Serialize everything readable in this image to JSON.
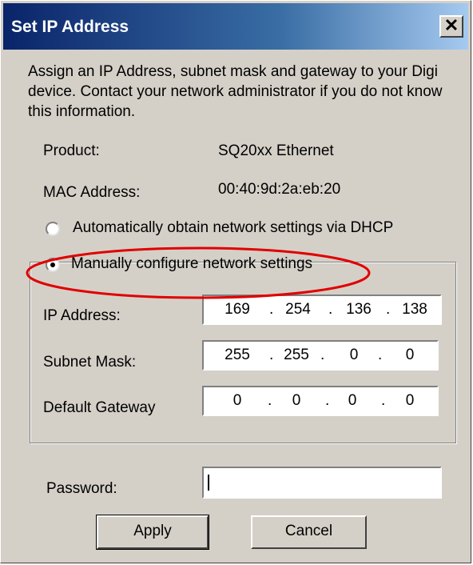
{
  "window": {
    "title": "Set IP Address",
    "close_glyph": "✕"
  },
  "description": "Assign an IP Address, subnet mask and gateway to your Digi device.  Contact your network administrator if you do not know this information.",
  "product": {
    "label": "Product:",
    "value": "SQ20xx Ethernet"
  },
  "mac": {
    "label": "MAC Address:",
    "value": "00:40:9d:2a:eb:20"
  },
  "options": {
    "dhcp_label": "Automatically obtain network settings via DHCP",
    "manual_label": "Manually configure network settings",
    "selected": "manual"
  },
  "network": {
    "ip_label": "IP Address:",
    "ip": [
      "169",
      "254",
      "136",
      "138"
    ],
    "subnet_label": "Subnet Mask:",
    "subnet": [
      "255",
      "255",
      "0",
      "0"
    ],
    "gateway_label": "Default Gateway",
    "gateway": [
      "0",
      "0",
      "0",
      "0"
    ],
    "separator": "."
  },
  "password": {
    "label": "Password:",
    "value": ""
  },
  "buttons": {
    "apply": "Apply",
    "cancel": "Cancel"
  },
  "annotation": {
    "color": "#e00000"
  }
}
